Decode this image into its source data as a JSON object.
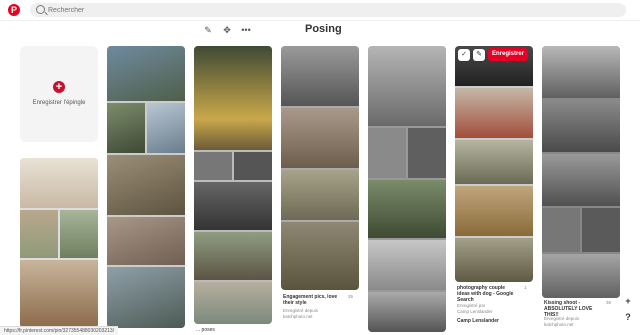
{
  "app": {
    "logo": "P"
  },
  "search": {
    "placeholder": "Rechercher"
  },
  "board": {
    "title": "Posing"
  },
  "toolbar": {
    "edit_icon": "pencil-icon",
    "move_icon": "move-icon",
    "more_icon": "ellipsis-icon"
  },
  "add_pin": {
    "label": "Enregistrer l'épingle",
    "symbol": "+"
  },
  "save": {
    "label": "Enregistrer"
  },
  "captions": {
    "c4_title": "Engagement pics, love their style",
    "c4_count": "35",
    "c4_src": "Enregistré depuis\nkatchphoto.net",
    "c3_title": "... poses",
    "c5_title": "photography couple ideas with dog - Google Search",
    "c5_count": "1",
    "c5_by": "Enregistré par\nCamp Lenslander",
    "c5_board": "Camp Lenslander",
    "c7_title": "Kissing shoot - ABSOLUTELY LOVE THIS!!",
    "c7_count": "36",
    "c7_src": "Enregistré depuis\nkatchphoto.net"
  },
  "status": {
    "url": "https://fr.pinterest.com/pin/327355488030203213/"
  },
  "zoom": {
    "in": "+",
    "help": "?"
  },
  "colors": {
    "brand": "#e60023",
    "search_bg": "#efefef"
  }
}
